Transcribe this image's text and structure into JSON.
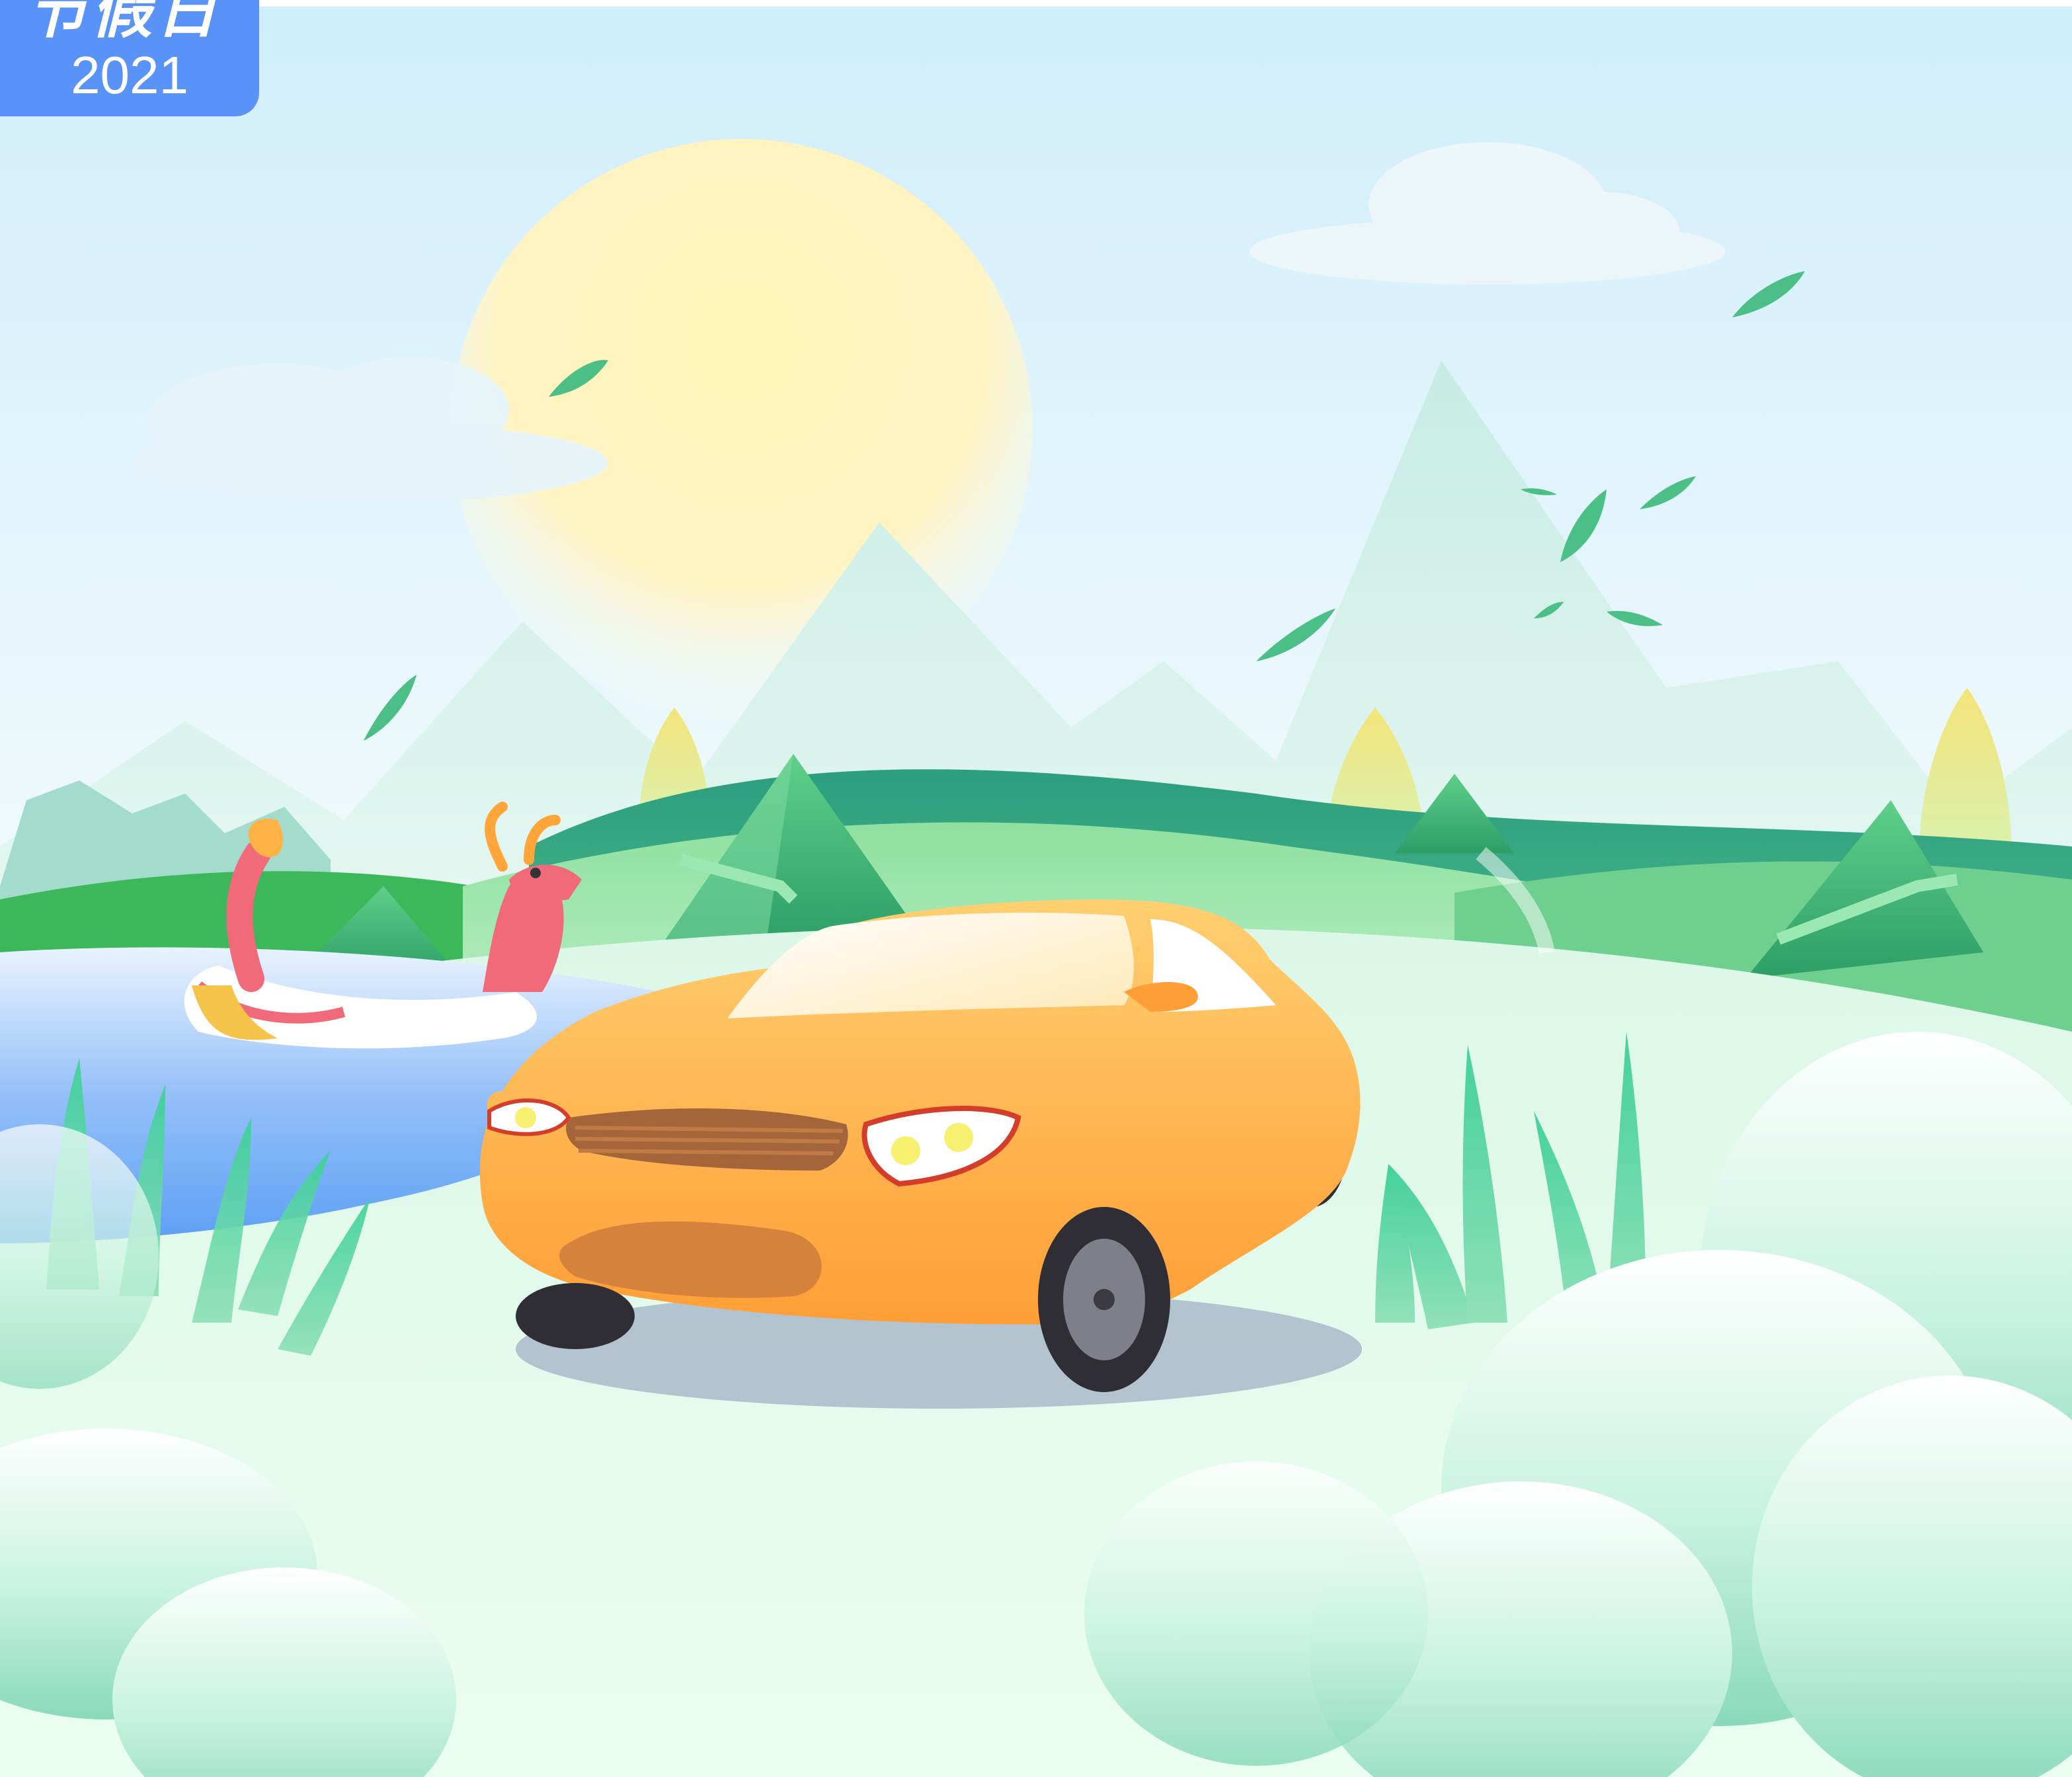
{
  "badge": {
    "title": "节假日",
    "year": "2021"
  },
  "colors": {
    "badge_bg": "#5a93f7",
    "sky_top": "#cfeefb",
    "sun": "#fff3b0",
    "mountain": "#cfeee8",
    "hill": "#7fd7a2",
    "road": "#e6fbee",
    "car_body": "#ffab42",
    "lake": "#5d9ff5",
    "dragon": "#f06a7a",
    "bush": "#8ce0bf"
  },
  "scene": {
    "elements": [
      "sun",
      "clouds",
      "mountains",
      "hills",
      "zongzi",
      "trees",
      "lake",
      "dragon-boat",
      "car",
      "grass",
      "bushes",
      "leaves"
    ]
  }
}
